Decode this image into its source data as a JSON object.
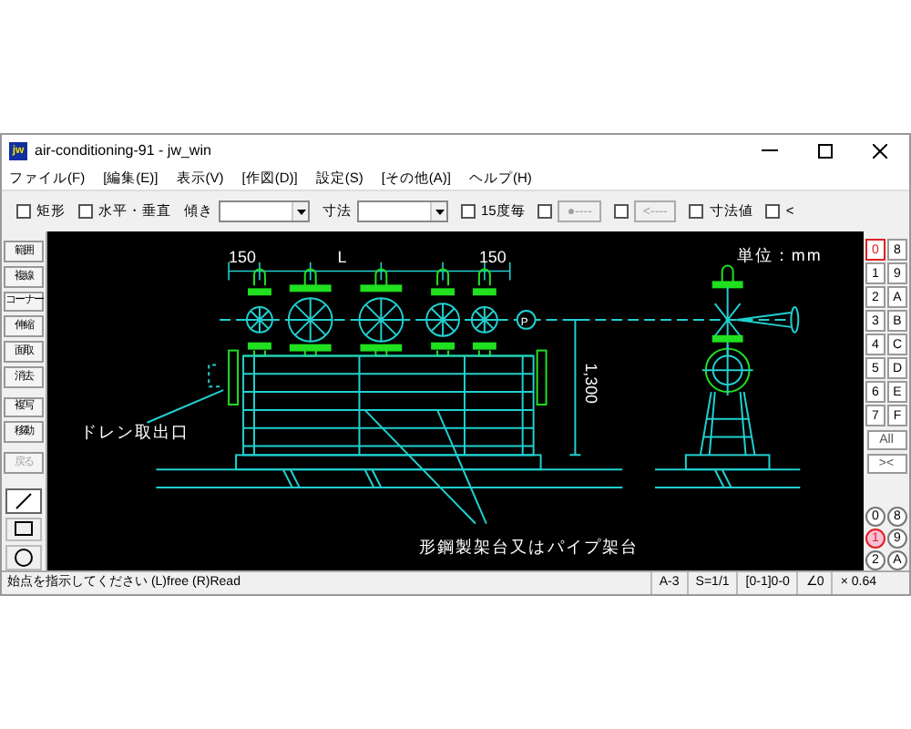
{
  "window": {
    "logo": "jw",
    "title": "air-conditioning-91 - jw_win"
  },
  "menu": [
    "ファイル(F)",
    "[編集(E)]",
    "表示(V)",
    "[作図(D)]",
    "設定(S)",
    "[その他(A)]",
    "ヘルプ(H)"
  ],
  "toolbar": [
    {
      "kind": "checkbox",
      "label": "矩形",
      "checked": false
    },
    {
      "kind": "checkbox",
      "label": "水平・垂直",
      "checked": false
    },
    {
      "kind": "select",
      "label": "傾き"
    },
    {
      "kind": "select",
      "label": "寸法"
    },
    {
      "kind": "checkbox",
      "label": "15度毎",
      "checked": false
    },
    {
      "kind": "checkbutton",
      "checked": false,
      "button": "●----",
      "disabled": true
    },
    {
      "kind": "checkbutton",
      "checked": false,
      "button": "<----",
      "disabled": true
    },
    {
      "kind": "checkbox",
      "label": "寸法値",
      "checked": false
    },
    {
      "kind": "checkbox",
      "label": "<",
      "checked": false
    }
  ],
  "tools": [
    {
      "label": "範囲",
      "disabled": false
    },
    {
      "label": "複線",
      "disabled": false
    },
    {
      "label": "コーナー",
      "disabled": false
    },
    {
      "label": "伸縮",
      "disabled": false
    },
    {
      "label": "面取",
      "disabled": false
    },
    {
      "label": "消去",
      "disabled": false
    },
    {
      "label": "複写",
      "disabled": false
    },
    {
      "label": "移動",
      "disabled": false
    },
    {
      "label": "戻る",
      "disabled": true
    }
  ],
  "draw_tools": [
    {
      "kind": "line",
      "selected": true
    },
    {
      "kind": "rect",
      "selected": false
    },
    {
      "kind": "circle",
      "selected": false
    }
  ],
  "drawing": {
    "labels": [
      "150",
      "L",
      "150",
      "単位：mm",
      "P",
      "1,300",
      "ドレン取出口",
      "形鋼製架台又はパイプ架台"
    ]
  },
  "layers": [
    {
      "label": "0",
      "selected": true
    },
    {
      "label": "8",
      "selected": false
    },
    {
      "label": "1",
      "selected": false
    },
    {
      "label": "9",
      "selected": false
    },
    {
      "label": "2",
      "selected": false
    },
    {
      "label": "A",
      "selected": false
    },
    {
      "label": "3",
      "selected": false
    },
    {
      "label": "B",
      "selected": false
    },
    {
      "label": "4",
      "selected": false
    },
    {
      "label": "C",
      "selected": false
    },
    {
      "label": "5",
      "selected": false
    },
    {
      "label": "D",
      "selected": false
    },
    {
      "label": "6",
      "selected": false
    },
    {
      "label": "E",
      "selected": false
    },
    {
      "label": "7",
      "selected": false
    },
    {
      "label": "F",
      "selected": false
    }
  ],
  "layer_buttons": [
    "All",
    "><"
  ],
  "layer_groups": [
    {
      "label": "0",
      "selected": false
    },
    {
      "label": "8",
      "selected": false
    },
    {
      "label": "1",
      "selected": true
    },
    {
      "label": "9",
      "selected": false
    },
    {
      "label": "2",
      "selected": false
    },
    {
      "label": "A",
      "selected": false
    }
  ],
  "status_bar": {
    "message": "始点を指示してください (L)free (R)Read",
    "fields": [
      "A-3",
      "S=1/1",
      "[0-1]0-0",
      "∠0",
      "× 0.64"
    ]
  }
}
